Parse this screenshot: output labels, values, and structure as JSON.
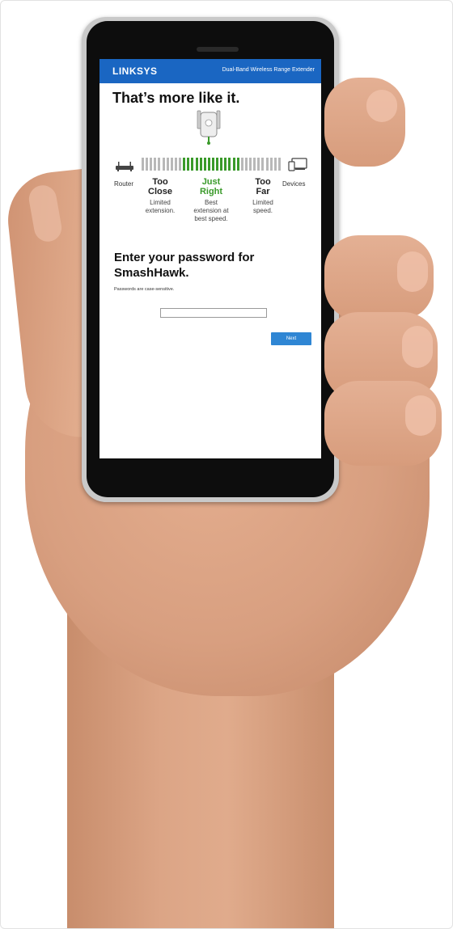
{
  "header": {
    "brand": "LINKSYS",
    "product": "Dual-Band Wireless Range Extender"
  },
  "status": {
    "heading": "That’s more like it.",
    "left_end_label": "Router",
    "right_end_label": "Devices",
    "zones": [
      {
        "title": "Too\nClose",
        "description": "Limited\nextension."
      },
      {
        "title": "Just\nRight",
        "description": "Best\nextension at\nbest speed."
      },
      {
        "title": "Too\nFar",
        "description": "Limited\nspeed."
      }
    ],
    "selected_zone": "Just Right"
  },
  "password": {
    "heading": "Enter your password for SmashHawk.",
    "hint": "Passwords are case-sensitive.",
    "input_value": "",
    "next_label": "Next"
  },
  "colors": {
    "header_blue": "#1a66c2",
    "good_green": "#3a9a2a",
    "button_blue": "#2f86d4",
    "meter_gray": "#b8b8b8"
  },
  "icons": [
    "linksys-logo",
    "extender-icon",
    "router-icon",
    "devices-icon",
    "signal-meter"
  ]
}
